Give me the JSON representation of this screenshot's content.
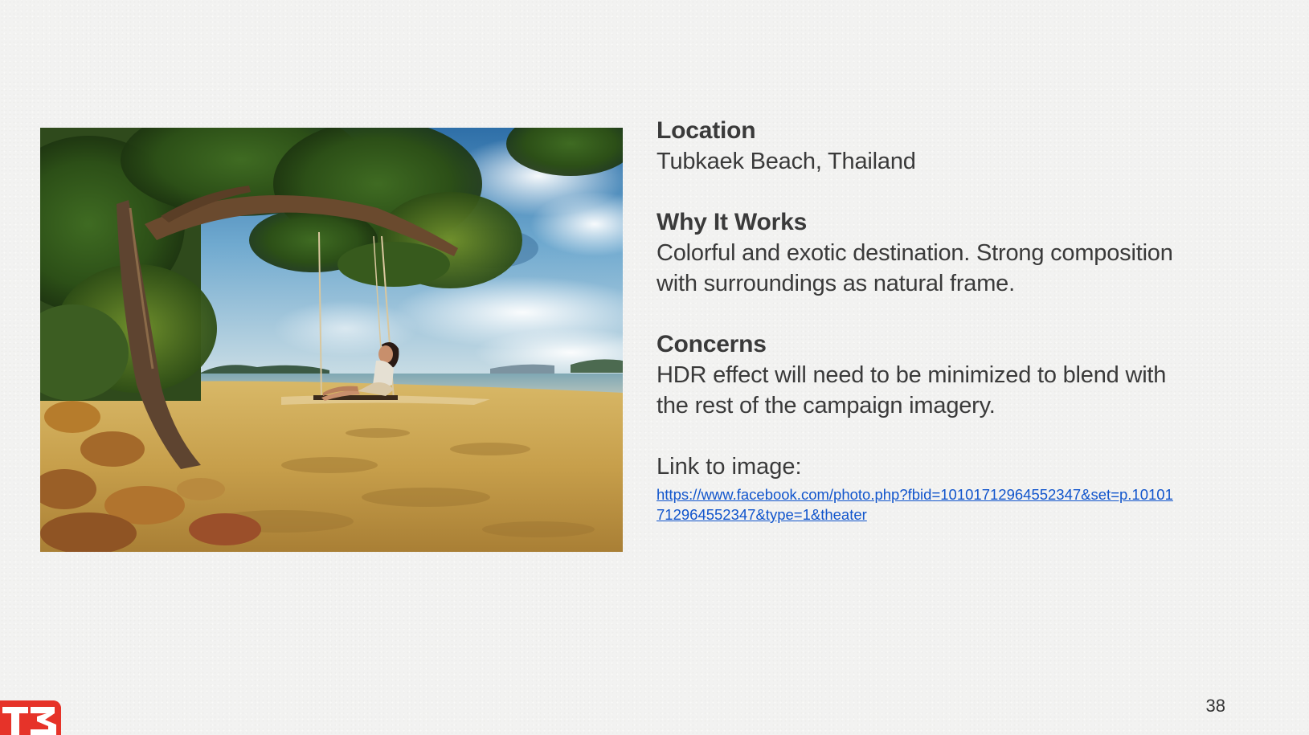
{
  "photo": {
    "alt": "Woman on rope swing under tree at beach"
  },
  "location": {
    "heading": "Location",
    "value": "Tubkaek Beach, Thailand"
  },
  "why": {
    "heading": "Why It Works",
    "value": "Colorful and exotic destination. Strong composition with surroundings as natural frame."
  },
  "concerns": {
    "heading": "Concerns",
    "value": "HDR effect will need to be minimized to blend with the rest of the campaign imagery."
  },
  "link": {
    "label": "Link to image:",
    "url": "https://www.facebook.com/photo.php?fbid=10101712964552347&set=p.10101712964552347&type=1&theater"
  },
  "page_number": "38",
  "logo": {
    "text": "T3"
  },
  "colors": {
    "brand_red": "#e63329",
    "link_blue": "#1155cc",
    "text": "#3a3a3a"
  }
}
